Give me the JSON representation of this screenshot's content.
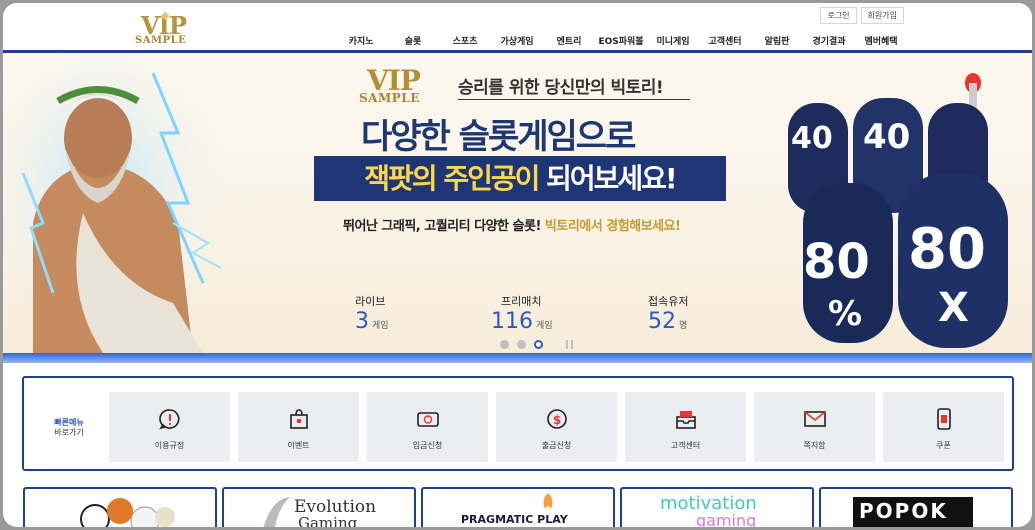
{
  "header": {
    "logo_top": "VIP",
    "logo_bottom": "SAMPLE",
    "login": "로그인",
    "signup": "회원가입",
    "nav": [
      "카지노",
      "슬롯",
      "스포츠",
      "가상게임",
      "엔트리",
      "EOS파워볼",
      "미니게임",
      "고객센터",
      "알림판",
      "경기결과",
      "멤버혜택"
    ]
  },
  "banner": {
    "logo_top": "VIP",
    "logo_bottom": "SAMPLE",
    "tagline": "승리를 위한 당신만의 빅토리!",
    "headline": "다양한 슬롯게임으로",
    "headline2_highlight": "잭팟의 주인공이",
    "headline2_rest": " 되어보세요!",
    "subcopy_main": "뛰어난 그래픽, 고퀄리티 다양한 슬롯! ",
    "subcopy_highlight": "빅토리에서 경험해보세요!",
    "slot_texts": [
      "40",
      "40",
      "80",
      "80",
      "%",
      "X"
    ],
    "stats": [
      {
        "label": "라이브",
        "value": "3",
        "unit": "게임"
      },
      {
        "label": "프리매치",
        "value": "116",
        "unit": "게임"
      },
      {
        "label": "접속유저",
        "value": "52",
        "unit": "명"
      }
    ],
    "active_slide": 3
  },
  "quick_menu": {
    "title_a": "빠른메뉴",
    "title_b": "바로가기",
    "items": [
      {
        "label": "이용규정",
        "icon": "alert-circle-icon"
      },
      {
        "label": "이벤트",
        "icon": "gift-bag-icon"
      },
      {
        "label": "입금신청",
        "icon": "money-card-icon"
      },
      {
        "label": "출금신청",
        "icon": "dollar-circle-icon"
      },
      {
        "label": "고객센터",
        "icon": "inbox-tray-icon"
      },
      {
        "label": "쪽지함",
        "icon": "mail-icon"
      },
      {
        "label": "쿠폰",
        "icon": "coupon-phone-icon"
      }
    ]
  },
  "providers": [
    "Evolution",
    "Gaming",
    "PRAGMATIC PLAY",
    "motivation",
    "gaming",
    "POPOK"
  ],
  "colors": {
    "brand_navy": "#1f3f8f",
    "accent_blue": "#2f57c4",
    "gold": "#b58d36",
    "highlight_yellow": "#ffd84a"
  }
}
